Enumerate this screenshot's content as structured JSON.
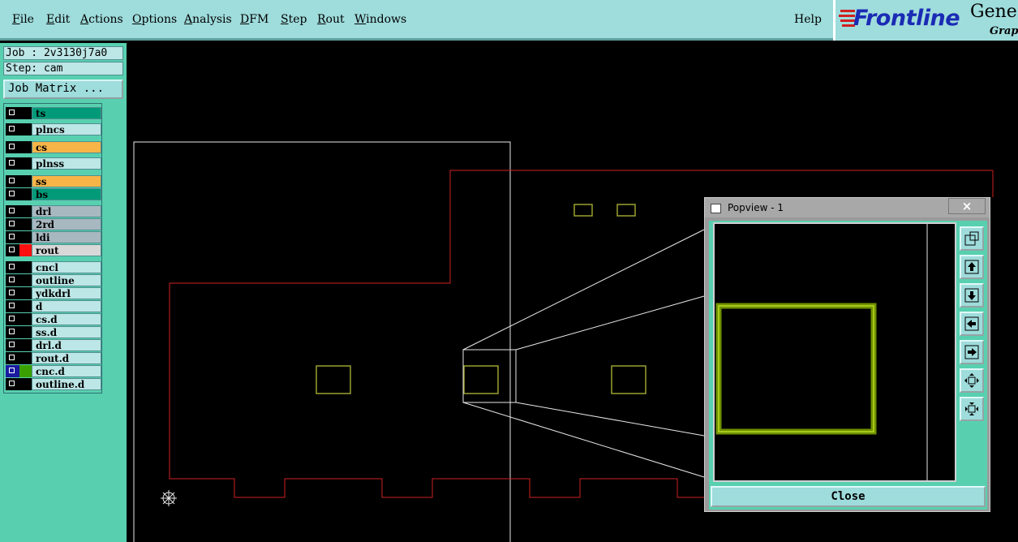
{
  "menubar": {
    "items": [
      {
        "pre": "",
        "ul": "F",
        "post": "ile"
      },
      {
        "pre": "",
        "ul": "E",
        "post": "dit"
      },
      {
        "pre": "",
        "ul": "A",
        "post": "ctions"
      },
      {
        "pre": "",
        "ul": "O",
        "post": "ptions"
      },
      {
        "pre": "",
        "ul": "A",
        "post": "nalysis"
      },
      {
        "pre": "",
        "ul": "D",
        "post": "FM"
      },
      {
        "pre": "",
        "ul": "S",
        "post": "tep"
      },
      {
        "pre": "",
        "ul": "R",
        "post": "out"
      },
      {
        "pre": "",
        "ul": "W",
        "post": "indows"
      }
    ],
    "help": "Help"
  },
  "brand": {
    "logo": "Frontline",
    "product": "Genes",
    "sub": "Graph"
  },
  "info": {
    "job": "Job : 2v3130j7a0",
    "step": "Step: cam",
    "job_matrix": "Job Matrix ..."
  },
  "layers": [
    {
      "name": "ts",
      "color": "#009a78"
    },
    {
      "name": "plncs",
      "color": "#bde6e6"
    },
    {
      "name": "cs",
      "color": "#f7b548"
    },
    {
      "name": "plnss",
      "color": "#bde6e6"
    },
    {
      "name": "ss",
      "color": "#f7b548"
    },
    {
      "name": "bs",
      "color": "#009a78"
    },
    {
      "name": "drl",
      "color": "#a8b8c0"
    },
    {
      "name": "2rd",
      "color": "#a8b8c0"
    },
    {
      "name": "ldi",
      "color": "#a8b8c0"
    },
    {
      "name": "rout",
      "color": "#d8d8d8"
    },
    {
      "name": "cncl",
      "color": "#bde6e6"
    },
    {
      "name": "outline",
      "color": "#bde6e6"
    },
    {
      "name": "ydkdrl",
      "color": "#bde6e6"
    },
    {
      "name": "d",
      "color": "#bde6e6"
    },
    {
      "name": "cs.d",
      "color": "#bde6e6"
    },
    {
      "name": "ss.d",
      "color": "#bde6e6"
    },
    {
      "name": "drl.d",
      "color": "#bde6e6"
    },
    {
      "name": "rout.d",
      "color": "#bde6e6"
    },
    {
      "name": "cnc.d",
      "color": "#bde6e6"
    },
    {
      "name": "outline.d",
      "color": "#bde6e6"
    }
  ],
  "popview": {
    "title": "Popview - 1",
    "close_x": "×",
    "close_label": "Close"
  },
  "colors": {
    "outline": "#d02020",
    "pad": "#9aa030",
    "zoom": "#e8e8e8",
    "pad_highlight": "#7a9a00"
  }
}
